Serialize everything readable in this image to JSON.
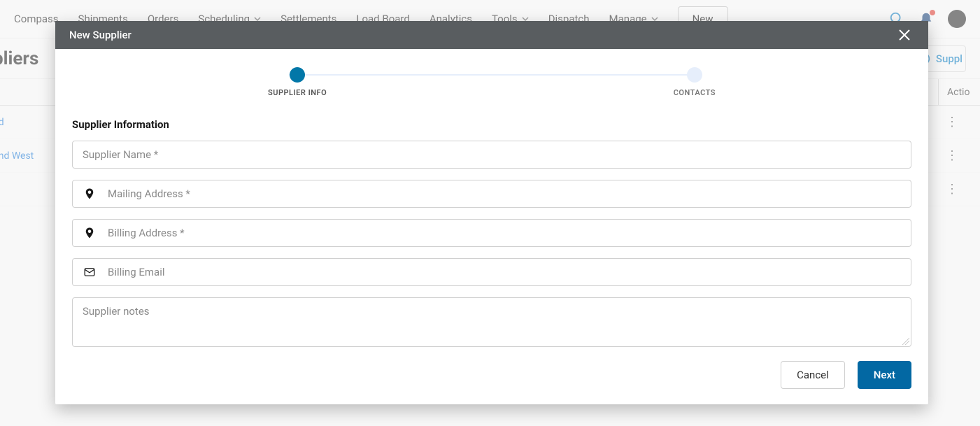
{
  "brand": "Compass",
  "nav": {
    "shipments": "Shipments",
    "orders": "Orders",
    "scheduling": "Scheduling",
    "settlements": "Settlements",
    "load_board": "Load Board",
    "analytics": "Analytics",
    "tools": "Tools",
    "dispatch": "Dispatch",
    "manage": "Manage",
    "new_button": "New"
  },
  "page": {
    "title_fragment": "pliers",
    "add_supplier_fragment": "Suppl",
    "actions_header_fragment": "Actio"
  },
  "rows": [
    {
      "name_fragment": "nd"
    },
    {
      "name_fragment": "und West"
    },
    {
      "name_fragment": ""
    }
  ],
  "modal": {
    "title": "New Supplier",
    "stepper": {
      "step1": "SUPPLIER INFO",
      "step2": "CONTACTS"
    },
    "section_title": "Supplier Information",
    "fields": {
      "supplier_name_placeholder": "Supplier Name *",
      "mailing_address_placeholder": "Mailing Address *",
      "billing_address_placeholder": "Billing Address *",
      "billing_email_placeholder": "Billing Email",
      "notes_placeholder": "Supplier notes"
    },
    "buttons": {
      "cancel": "Cancel",
      "next": "Next"
    }
  }
}
